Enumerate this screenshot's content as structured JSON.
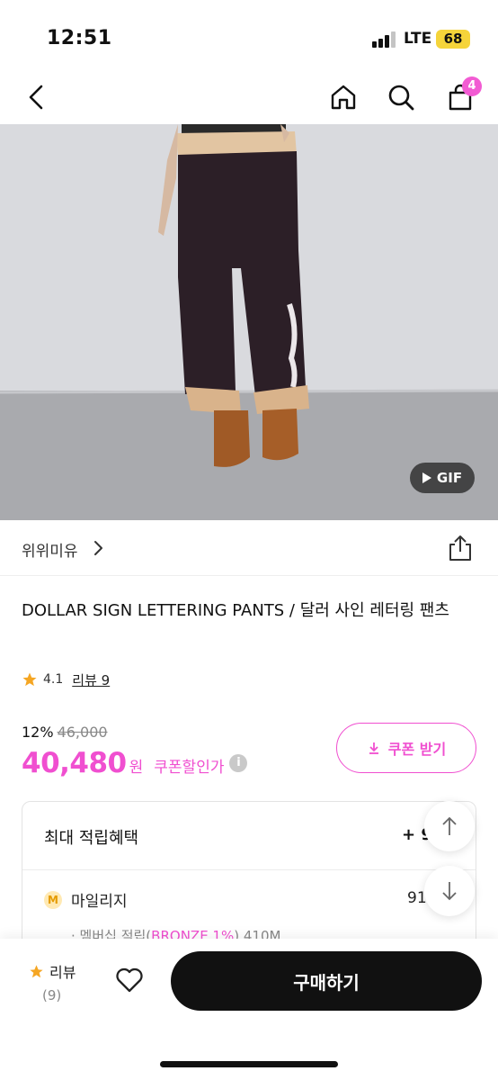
{
  "status_bar": {
    "time": "12:51",
    "network": "LTE",
    "battery": "68"
  },
  "nav": {
    "cart_count": "4"
  },
  "hero": {
    "gif_label": "GIF"
  },
  "brand": {
    "name": "위위미유"
  },
  "product": {
    "title": "DOLLAR SIGN LETTERING PANTS / 달러 사인 레터링 팬츠",
    "rating": "4.1",
    "review_link": "리뷰 9"
  },
  "price": {
    "discount_rate": "12%",
    "original": "46,000",
    "final": "40,480",
    "currency": "원",
    "coupon_price_label": "쿠폰할인가",
    "info": "i",
    "coupon_button": "쿠폰 받기"
  },
  "benefits": {
    "title": "최대 적립혜택",
    "total": "+ 9",
    "mileage_icon": "M",
    "mileage_label": "마일리지",
    "mileage_value": "91",
    "membership_prefix": "· 멤버십 적립(",
    "membership_grade": "BRONZE 1%",
    "membership_suffix": ") 410M"
  },
  "bottom_bar": {
    "review_label": "리뷰",
    "review_count": "(9)",
    "buy_label": "구매하기"
  },
  "colors": {
    "accent": "#f04fd0",
    "badge": "#f25bd3",
    "star": "#f5a623",
    "battery": "#f5d43a"
  }
}
